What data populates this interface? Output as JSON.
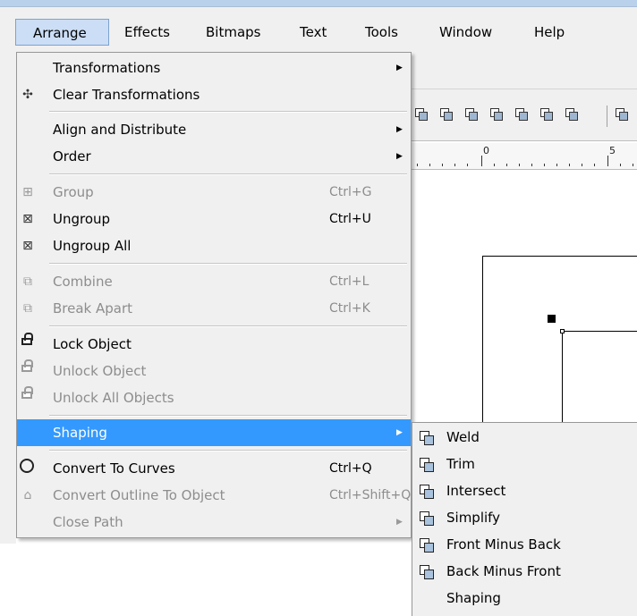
{
  "menubar": {
    "items": [
      {
        "label": "Arrange"
      },
      {
        "label": "Effects"
      },
      {
        "label": "Bitmaps"
      },
      {
        "label": "Text"
      },
      {
        "label": "Tools"
      },
      {
        "label": "Window"
      },
      {
        "label": "Help"
      }
    ]
  },
  "ruler": {
    "labels": [
      "0",
      "5"
    ]
  },
  "menu": {
    "items": [
      {
        "label": "Transformations",
        "icon": "none",
        "shortcut": "",
        "submenu": true,
        "enabled": true
      },
      {
        "label": "Clear Transformations",
        "icon": "clear-transformations-icon",
        "shortcut": "",
        "submenu": false,
        "enabled": true
      },
      {
        "label": "Align and Distribute",
        "icon": "none",
        "shortcut": "",
        "submenu": true,
        "enabled": true
      },
      {
        "label": "Order",
        "icon": "none",
        "shortcut": "",
        "submenu": true,
        "enabled": true
      },
      {
        "label": "Group",
        "icon": "group-icon",
        "shortcut": "Ctrl+G",
        "submenu": false,
        "enabled": false
      },
      {
        "label": "Ungroup",
        "icon": "ungroup-icon",
        "shortcut": "Ctrl+U",
        "submenu": false,
        "enabled": true
      },
      {
        "label": "Ungroup All",
        "icon": "ungroup-all-icon",
        "shortcut": "",
        "submenu": false,
        "enabled": true
      },
      {
        "label": "Combine",
        "icon": "combine-icon",
        "shortcut": "Ctrl+L",
        "submenu": false,
        "enabled": false
      },
      {
        "label": "Break Apart",
        "icon": "break-apart-icon",
        "shortcut": "Ctrl+K",
        "submenu": false,
        "enabled": false
      },
      {
        "label": "Lock Object",
        "icon": "lock-icon",
        "shortcut": "",
        "submenu": false,
        "enabled": true
      },
      {
        "label": "Unlock Object",
        "icon": "unlock-icon",
        "shortcut": "",
        "submenu": false,
        "enabled": false
      },
      {
        "label": "Unlock All Objects",
        "icon": "unlock-all-icon",
        "shortcut": "",
        "submenu": false,
        "enabled": false
      },
      {
        "label": "Shaping",
        "icon": "none",
        "shortcut": "",
        "submenu": true,
        "enabled": true,
        "highlighted": true
      },
      {
        "label": "Convert To Curves",
        "icon": "convert-to-curves-icon",
        "shortcut": "Ctrl+Q",
        "submenu": false,
        "enabled": true
      },
      {
        "label": "Convert Outline To Object",
        "icon": "convert-outline-icon",
        "shortcut": "Ctrl+Shift+Q",
        "submenu": false,
        "enabled": false
      },
      {
        "label": "Close Path",
        "icon": "none",
        "shortcut": "",
        "submenu": true,
        "enabled": false
      }
    ]
  },
  "submenu": {
    "items": [
      {
        "label": "Weld",
        "icon": "weld-icon"
      },
      {
        "label": "Trim",
        "icon": "trim-icon"
      },
      {
        "label": "Intersect",
        "icon": "intersect-icon"
      },
      {
        "label": "Simplify",
        "icon": "simplify-icon"
      },
      {
        "label": "Front Minus Back",
        "icon": "front-minus-back-icon"
      },
      {
        "label": "Back Minus Front",
        "icon": "back-minus-front-icon"
      },
      {
        "label": "Shaping",
        "icon": "none"
      }
    ]
  },
  "colors": {
    "highlight": "#3399ff",
    "menu_bg": "#f0f0f0",
    "disabled_text": "#8d8d8d",
    "active_menubar": "#ccdef5"
  }
}
